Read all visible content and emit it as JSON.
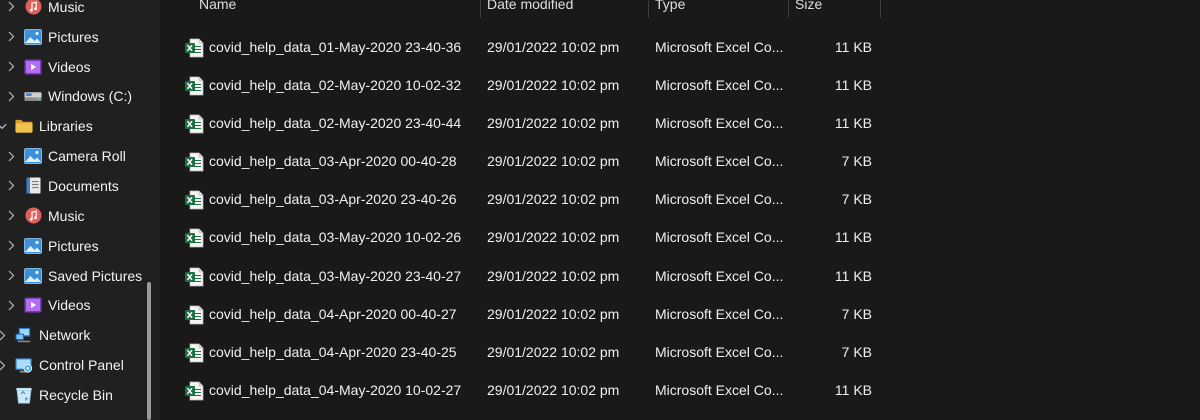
{
  "sidebar": {
    "items": [
      {
        "label": "Music",
        "icon": "music-icon",
        "level": 2,
        "expand": "collapsed"
      },
      {
        "label": "Pictures",
        "icon": "pictures-icon",
        "level": 2,
        "expand": "collapsed"
      },
      {
        "label": "Videos",
        "icon": "videos-icon",
        "level": 2,
        "expand": "collapsed"
      },
      {
        "label": "Windows (C:)",
        "icon": "drive-icon",
        "level": 2,
        "expand": "collapsed"
      },
      {
        "label": "Libraries",
        "icon": "folder-icon",
        "level": 1,
        "expand": "expanded"
      },
      {
        "label": "Camera Roll",
        "icon": "pictures-icon",
        "level": 2,
        "expand": "collapsed"
      },
      {
        "label": "Documents",
        "icon": "documents-icon",
        "level": 2,
        "expand": "collapsed"
      },
      {
        "label": "Music",
        "icon": "music-icon",
        "level": 2,
        "expand": "collapsed"
      },
      {
        "label": "Pictures",
        "icon": "pictures-icon",
        "level": 2,
        "expand": "collapsed"
      },
      {
        "label": "Saved Pictures",
        "icon": "pictures-icon",
        "level": 2,
        "expand": "collapsed"
      },
      {
        "label": "Videos",
        "icon": "videos-icon",
        "level": 2,
        "expand": "collapsed"
      },
      {
        "label": "Network",
        "icon": "network-icon",
        "level": 1,
        "expand": "collapsed"
      },
      {
        "label": "Control Panel",
        "icon": "control-panel-icon",
        "level": 1,
        "expand": "collapsed"
      },
      {
        "label": "Recycle Bin",
        "icon": "recycle-bin-icon",
        "level": 1,
        "expand": "none"
      }
    ]
  },
  "columns": {
    "name": "Name",
    "date": "Date modified",
    "type": "Type",
    "size": "Size"
  },
  "files": [
    {
      "name": "covid_help_data_01-May-2020 23-40-36",
      "date": "29/01/2022 10:02 pm",
      "type": "Microsoft Excel Co...",
      "size": "11 KB"
    },
    {
      "name": "covid_help_data_02-May-2020 10-02-32",
      "date": "29/01/2022 10:02 pm",
      "type": "Microsoft Excel Co...",
      "size": "11 KB"
    },
    {
      "name": "covid_help_data_02-May-2020 23-40-44",
      "date": "29/01/2022 10:02 pm",
      "type": "Microsoft Excel Co...",
      "size": "11 KB"
    },
    {
      "name": "covid_help_data_03-Apr-2020 00-40-28",
      "date": "29/01/2022 10:02 pm",
      "type": "Microsoft Excel Co...",
      "size": "7 KB"
    },
    {
      "name": "covid_help_data_03-Apr-2020 23-40-26",
      "date": "29/01/2022 10:02 pm",
      "type": "Microsoft Excel Co...",
      "size": "7 KB"
    },
    {
      "name": "covid_help_data_03-May-2020 10-02-26",
      "date": "29/01/2022 10:02 pm",
      "type": "Microsoft Excel Co...",
      "size": "11 KB"
    },
    {
      "name": "covid_help_data_03-May-2020 23-40-27",
      "date": "29/01/2022 10:02 pm",
      "type": "Microsoft Excel Co...",
      "size": "11 KB"
    },
    {
      "name": "covid_help_data_04-Apr-2020 00-40-27",
      "date": "29/01/2022 10:02 pm",
      "type": "Microsoft Excel Co...",
      "size": "7 KB"
    },
    {
      "name": "covid_help_data_04-Apr-2020 23-40-25",
      "date": "29/01/2022 10:02 pm",
      "type": "Microsoft Excel Co...",
      "size": "7 KB"
    },
    {
      "name": "covid_help_data_04-May-2020 10-02-27",
      "date": "29/01/2022 10:02 pm",
      "type": "Microsoft Excel Co...",
      "size": "11 KB"
    }
  ],
  "colors": {
    "background": "#191919",
    "sidebar": "#202020",
    "excel_green": "#1d7044",
    "folder_yellow": "#f2c14e"
  }
}
